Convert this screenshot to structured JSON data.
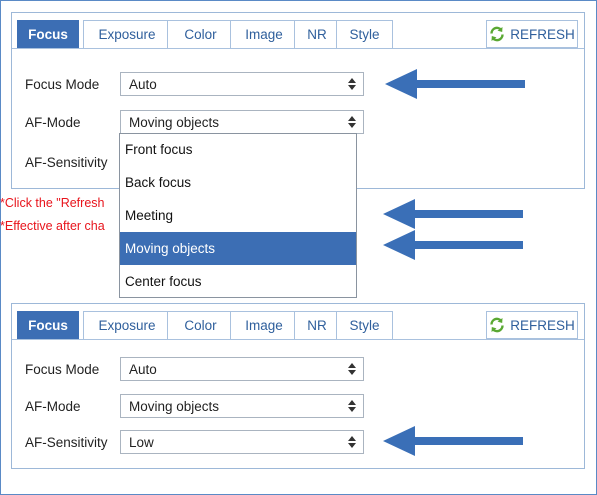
{
  "tabs": [
    "Focus",
    "Exposure",
    "Color",
    "Image",
    "NR",
    "Style"
  ],
  "refresh_label": "REFRESH",
  "top_panel": {
    "focus_mode": {
      "label": "Focus Mode",
      "value": "Auto"
    },
    "af_mode": {
      "label": "AF-Mode",
      "value": "Moving objects"
    },
    "af_sensitivity": {
      "label": "AF-Sensitivity"
    }
  },
  "notes": {
    "refresh_note": "*Click the \"Refresh",
    "effective_note": "*Effective after cha"
  },
  "dropdown": {
    "options": [
      "Front focus",
      "Back focus",
      "Meeting",
      "Moving objects",
      "Center focus"
    ],
    "selected_index": 3
  },
  "bottom_panel": {
    "focus_mode": {
      "label": "Focus Mode",
      "value": "Auto"
    },
    "af_mode": {
      "label": "AF-Mode",
      "value": "Moving objects"
    },
    "af_sensitivity": {
      "label": "AF-Sensitivity",
      "value": "Low"
    }
  },
  "colors": {
    "accent": "#3c6eb4",
    "arrow": "#3a6fb7",
    "note": "#e8141c",
    "refresh_icon": "#5aa832"
  }
}
